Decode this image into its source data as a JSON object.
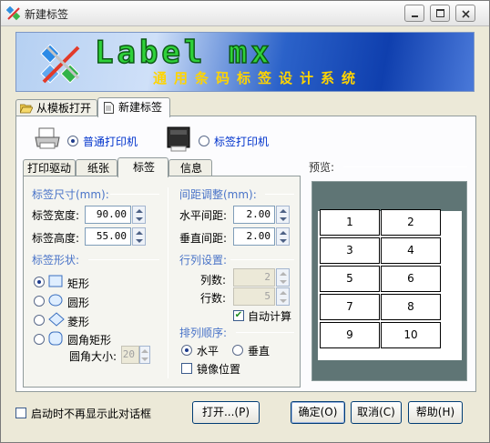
{
  "window": {
    "title": "新建标签"
  },
  "banner": {
    "title": "Label mx",
    "subtitle": "通用条码标签设计系统"
  },
  "tabs": [
    {
      "label": "从模板打开",
      "icon": "folder-open-icon"
    },
    {
      "label": "新建标签",
      "icon": "document-icon"
    }
  ],
  "printers": {
    "normal_label": "普通打印机",
    "label_label": "标签打印机",
    "selected": "normal"
  },
  "subtabs": [
    "打印驱动",
    "纸张",
    "标签",
    "信息"
  ],
  "subtabs_active": 2,
  "size_group": {
    "title": "标签尺寸(mm):",
    "width_label": "标签宽度:",
    "width_value": "90.00",
    "height_label": "标签高度:",
    "height_value": "55.00"
  },
  "shape_group": {
    "title": "标签形状:",
    "options": [
      "矩形",
      "圆形",
      "菱形",
      "圆角矩形"
    ],
    "selected": 0,
    "corner_label": "圆角大小:",
    "corner_value": "20"
  },
  "spacing_group": {
    "title": "间距调整(mm):",
    "h_label": "水平间距:",
    "h_value": "2.00",
    "v_label": "垂直间距:",
    "v_value": "2.00"
  },
  "rowcol_group": {
    "title": "行列设置:",
    "cols_label": "列数:",
    "cols_value": "2",
    "rows_label": "行数:",
    "rows_value": "5",
    "auto_label": "自动计算",
    "auto_checked": true
  },
  "order_group": {
    "title": "排列顺序:",
    "horizontal_label": "水平",
    "vertical_label": "垂直",
    "selected": "horizontal",
    "mirror_label": "镜像位置",
    "mirror_checked": false
  },
  "preview": {
    "title": "预览:",
    "cells": [
      "1",
      "2",
      "3",
      "4",
      "5",
      "6",
      "7",
      "8",
      "9",
      "10"
    ]
  },
  "footer": {
    "no_show_label": "启动时不再显示此对话框",
    "open_button": "打开...(P)",
    "ok_button": "确定(O)",
    "cancel_button": "取消(C)",
    "help_button": "帮助(H)"
  },
  "colors": {
    "accent": "#0033cc",
    "group_title": "#4a74c8",
    "preview_bg": "#5f7575"
  }
}
